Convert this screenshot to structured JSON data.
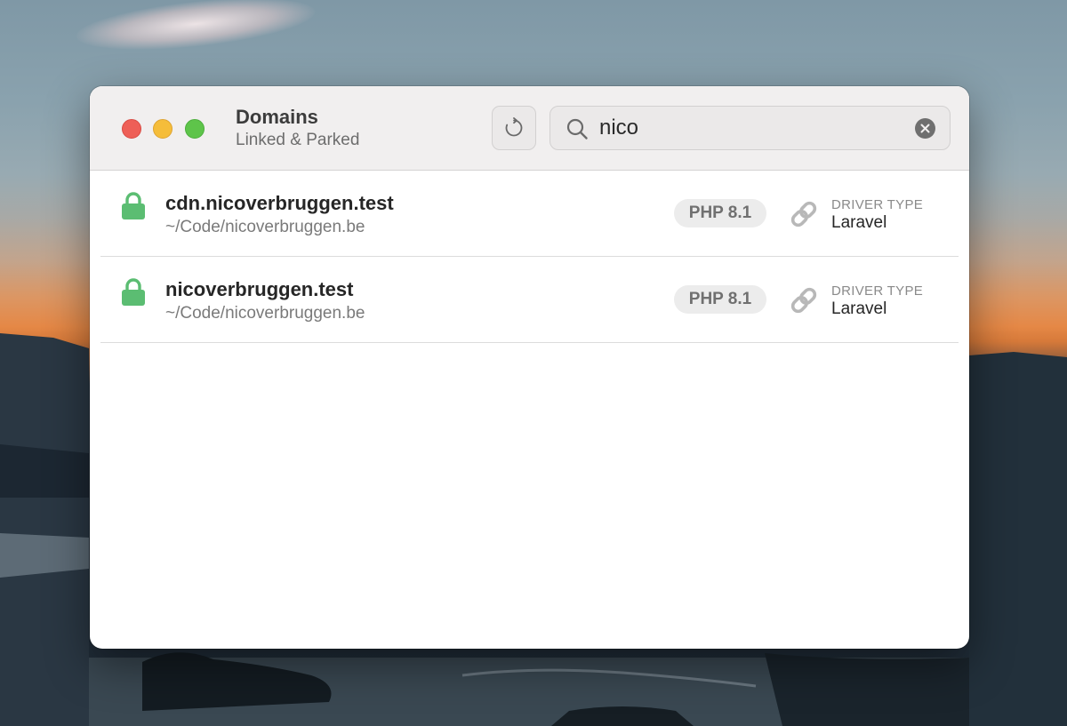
{
  "window": {
    "title": "Domains",
    "subtitle": "Linked & Parked"
  },
  "toolbar": {
    "refresh_icon": "refresh-icon"
  },
  "search": {
    "icon": "search-icon",
    "value": "nico",
    "clear_icon": "clear-icon"
  },
  "domains": [
    {
      "name": "cdn.nicoverbruggen.test",
      "path": "~/Code/nicoverbruggen.be",
      "secure_icon": "lock-icon",
      "php": "PHP 8.1",
      "link_icon": "link-icon",
      "driver_label": "DRIVER TYPE",
      "driver": "Laravel"
    },
    {
      "name": "nicoverbruggen.test",
      "path": "~/Code/nicoverbruggen.be",
      "secure_icon": "lock-icon",
      "php": "PHP 8.1",
      "link_icon": "link-icon",
      "driver_label": "DRIVER TYPE",
      "driver": "Laravel"
    }
  ],
  "colors": {
    "lock": "#5bbd72",
    "traffic_close": "#ee5f57",
    "traffic_minimize": "#f5bd3a",
    "traffic_maximize": "#5ec44a"
  }
}
